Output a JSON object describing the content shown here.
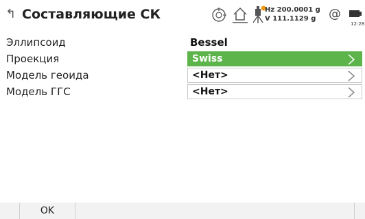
{
  "header": {
    "back_icon": "back-arrow-icon",
    "title": "Составляющие СК",
    "hz_line": "Hz 200.0001 g",
    "v_line": "V  111.1129 g",
    "at_symbol": "@",
    "time": "12:28"
  },
  "rows": [
    {
      "label": "Эллипсоид",
      "value": "Bessel"
    },
    {
      "label": "Проекция",
      "value": "Swiss"
    },
    {
      "label": "Модель геоида",
      "value": "<Нет>"
    },
    {
      "label": "Модель ГГС",
      "value": "<Нет>"
    }
  ],
  "footer": {
    "ok_label": "OK"
  },
  "colors": {
    "accent_green": "#5cb44b",
    "warning_orange": "#f39c12"
  }
}
